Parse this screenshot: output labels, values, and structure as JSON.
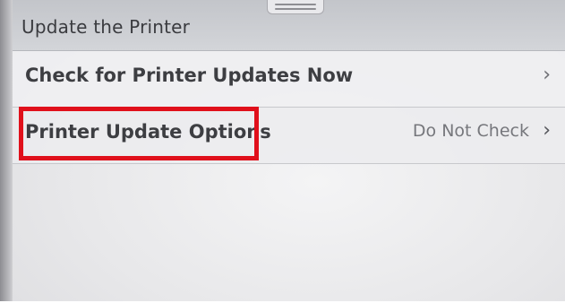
{
  "header": {
    "title": "Update the Printer"
  },
  "menu": {
    "items": [
      {
        "label": "Check for Printer Updates Now",
        "value": "",
        "chevron": "›"
      },
      {
        "label": "Printer Update Options",
        "value": "Do Not Check",
        "chevron": "›"
      }
    ]
  },
  "annotation": {
    "highlight_color": "#e0101b",
    "highlighted_item": "Printer Update Options"
  },
  "icons": {
    "chevron": "chevron-right-icon",
    "pull_tab": "pull-down-tab-icon"
  }
}
